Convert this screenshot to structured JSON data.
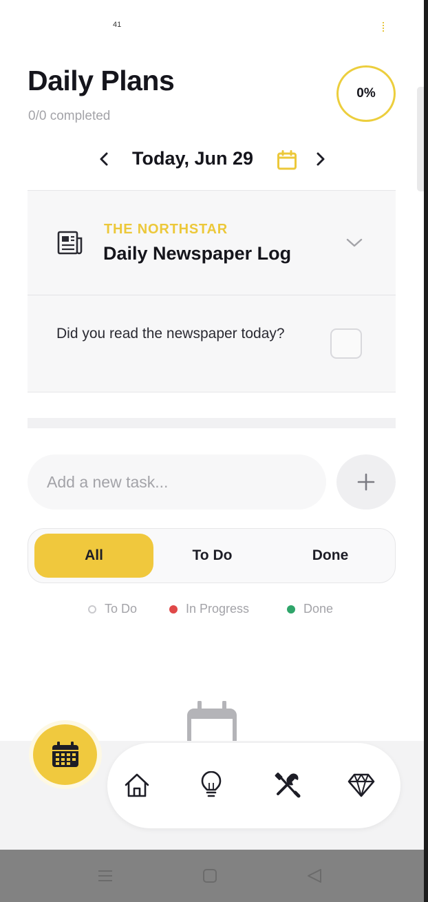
{
  "status_bar": {
    "left_text": "41"
  },
  "header": {
    "title": "Daily Plans",
    "subtitle": "0/0 completed",
    "progress_label": "0%",
    "progress_value": 0
  },
  "date_nav": {
    "label": "Today, Jun 29"
  },
  "plan_card": {
    "eyebrow": "THE NORTHSTAR",
    "title": "Daily Newspaper Log",
    "question": "Did you read the newspaper today?",
    "checked": false
  },
  "task_input": {
    "placeholder": "Add a new task..."
  },
  "add_button": {
    "label": "+"
  },
  "filter_tabs": [
    {
      "label": "All",
      "active": true
    },
    {
      "label": "To Do",
      "active": false
    },
    {
      "label": "Done",
      "active": false
    }
  ],
  "legend": [
    {
      "label": "To Do",
      "color": "#c9c9cd"
    },
    {
      "label": "In Progress",
      "color": "#e04848"
    },
    {
      "label": "Done",
      "color": "#2fa56a"
    }
  ],
  "colors": {
    "accent": "#f0c83d",
    "eyebrow": "#ecc83a",
    "text_primary": "#15151c",
    "text_muted": "#a3a3a8"
  },
  "bottom_nav": {
    "fab_icon": "calendar-icon",
    "items": [
      "home-icon",
      "lightbulb-icon",
      "tools-icon",
      "diamond-icon"
    ]
  },
  "system_nav": {
    "items": [
      "menu-icon",
      "home-square-icon",
      "back-triangle-icon"
    ]
  }
}
